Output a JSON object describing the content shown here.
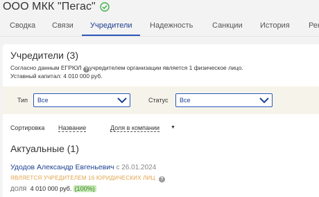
{
  "company": {
    "name": "ООО МКК \"Пегас\""
  },
  "tabs": [
    {
      "label": "Сводка"
    },
    {
      "label": "Связи"
    },
    {
      "label": "Учредители"
    },
    {
      "label": "Надежность"
    },
    {
      "label": "Санкции"
    },
    {
      "label": "История"
    },
    {
      "label": "Рек"
    }
  ],
  "main": {
    "title": "Учредители (3)",
    "desc_1": "Согласно данным ЕГРЮЛ",
    "desc_2": "учредителем организации является 1 физическое лицо.",
    "desc_3": "Уставный капитал: 4 010 000 руб.",
    "help_glyph": "?"
  },
  "filters": {
    "type_label": "Тип",
    "type_value": "Все",
    "status_label": "Статус",
    "status_value": "Все"
  },
  "sort": {
    "label": "Сортировка",
    "by_name": "Название",
    "by_share": "Доля в компании",
    "arrow": "▼"
  },
  "section": {
    "title": "Актуальные (1)"
  },
  "founder": {
    "name": "Удодов Александр Евгеньевич",
    "date": "с 26.01.2024",
    "role": "ЯВЛЯЕТСЯ УЧРЕДИТЕЛЕМ 16 ЮРИДИЧЕСКИХ ЛИЦ",
    "share_label": "ДОЛЯ",
    "share_amount": "4 010 000 руб.",
    "share_percent": "(100%)"
  },
  "colors": {
    "accent": "#2a57b8",
    "link": "#1b3f8f",
    "warning": "#e1a34a",
    "success": "#3a8a2a"
  }
}
